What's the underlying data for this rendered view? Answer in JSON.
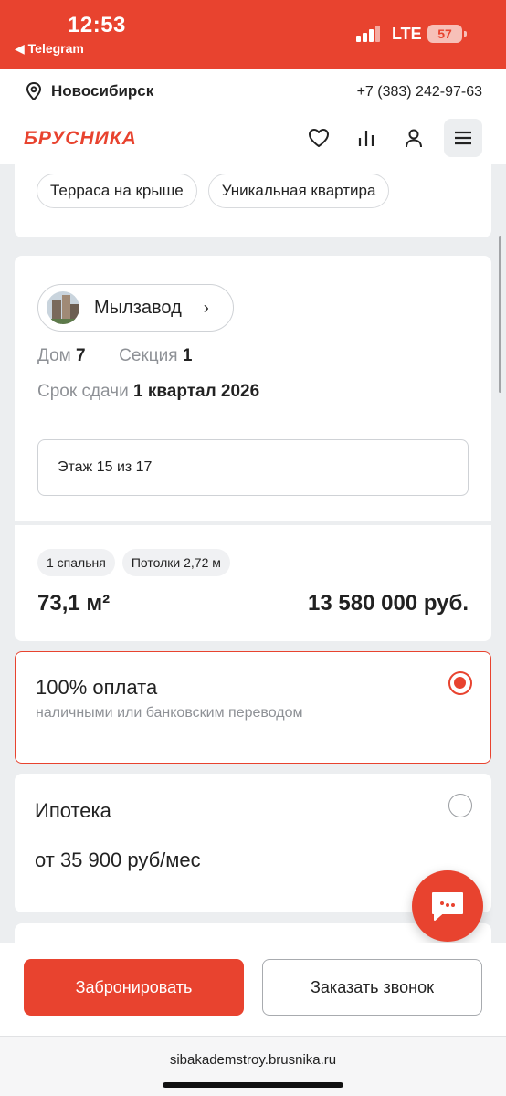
{
  "status_bar": {
    "time": "12:53",
    "back_app": "◀ Telegram",
    "network": "LTE",
    "battery": "57"
  },
  "header": {
    "city": "Новосибирск",
    "phone": "+7 (383) 242-97-63",
    "logo": "БРУСНИКА",
    "icons": [
      "heart-icon",
      "compare-icon",
      "user-icon",
      "menu-icon"
    ]
  },
  "features": {
    "chips": [
      "Терраса на крыше",
      "Уникальная квартира"
    ]
  },
  "building": {
    "project_name": "Мылзавод",
    "house_label": "Дом",
    "house_value": "7",
    "section_label": "Секция",
    "section_value": "1",
    "deadline_label": "Срок сдачи",
    "deadline_value": "1 квартал 2026",
    "floor": "Этаж 15 из 17"
  },
  "apartment": {
    "tags": [
      "1 спальня",
      "Потолки 2,72 м"
    ],
    "area": "73,1 м²",
    "price": "13 580 000 руб."
  },
  "payment_options": [
    {
      "title": "100% оплата",
      "subtitle": "наличными или банковским переводом",
      "selected": true
    },
    {
      "title": "Ипотека",
      "subtitle": "от 35 900 руб/мес",
      "selected": false
    }
  ],
  "actions": {
    "book": "Забронировать",
    "callback": "Заказать звонок"
  },
  "browser": {
    "url": "sibakademstroy.brusnika.ru"
  },
  "colors": {
    "accent": "#e8432f",
    "background": "#eceef0",
    "muted_text": "#8e9196"
  }
}
